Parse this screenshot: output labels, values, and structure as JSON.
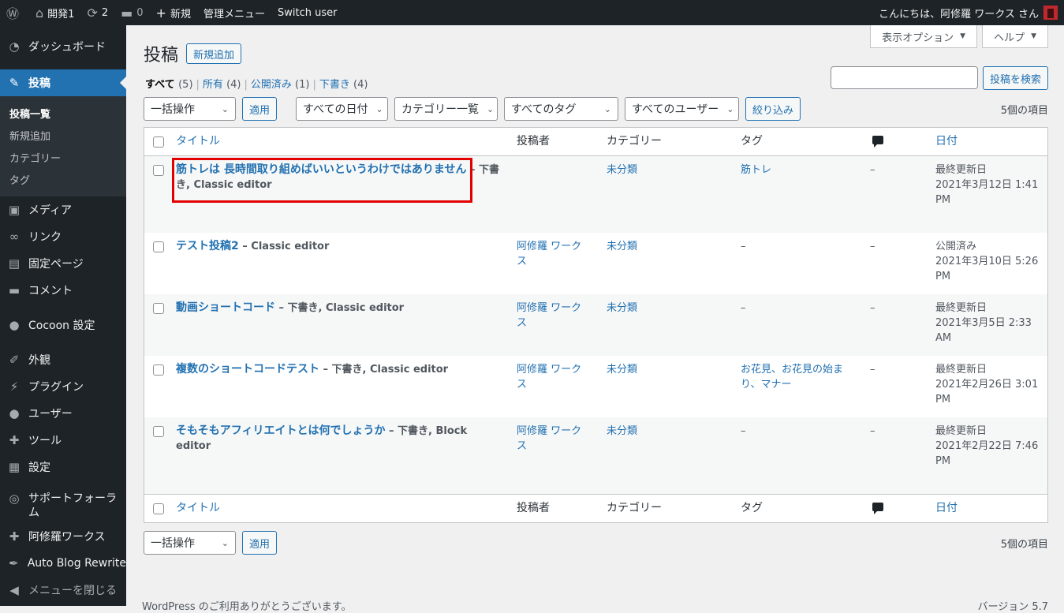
{
  "adminbar": {
    "site_name": "開発1",
    "updates": "2",
    "comments": "0",
    "new_label": "新規",
    "admin_menu": "管理メニュー",
    "switch_user": "Switch user",
    "greeting": "こんにちは、阿修羅 ワークス さん"
  },
  "menu": {
    "dashboard": "ダッシュボード",
    "posts": "投稿",
    "sub": [
      "投稿一覧",
      "新規追加",
      "カテゴリー",
      "タグ"
    ],
    "media": "メディア",
    "links": "リンク",
    "pages": "固定ページ",
    "comments": "コメント",
    "cocoon": "Cocoon 設定",
    "appearance": "外観",
    "plugins": "プラグイン",
    "users": "ユーザー",
    "tools": "ツール",
    "settings": "設定",
    "support": "サポートフォーラム",
    "ashura": "阿修羅ワークス",
    "autoblog": "Auto Blog Rewrite",
    "collapse": "メニューを閉じる"
  },
  "screen_meta": {
    "options": "表示オプション",
    "help": "ヘルプ"
  },
  "page": {
    "title": "投稿",
    "add_new": "新規追加"
  },
  "views": [
    {
      "label": "すべて",
      "count": "(5)"
    },
    {
      "label": "所有",
      "count": "(4)"
    },
    {
      "label": "公開済み",
      "count": "(1)"
    },
    {
      "label": "下書き",
      "count": "(4)"
    }
  ],
  "search": {
    "button": "投稿を検索"
  },
  "filters": {
    "bulk": "一括操作",
    "apply": "適用",
    "dates": "すべての日付",
    "categories": "カテゴリー一覧",
    "tags": "すべてのタグ",
    "users": "すべてのユーザー",
    "filter": "絞り込み",
    "items_count": "5個の項目"
  },
  "columns": {
    "title": "タイトル",
    "author": "投稿者",
    "category": "カテゴリー",
    "tag": "タグ",
    "date": "日付"
  },
  "rows": [
    {
      "title": "筋トレは 長時間取り組めばいいというわけではありません",
      "state": " – 下書き, Classic editor",
      "author": "",
      "category": "未分類",
      "tags": "筋トレ",
      "comments": "–",
      "date_status": "最終更新日",
      "date": "2021年3月12日 1:41 PM"
    },
    {
      "title": "テスト投稿2",
      "state": " – Classic editor",
      "author": "阿修羅 ワークス",
      "category": "未分類",
      "tags": "–",
      "comments": "–",
      "date_status": "公開済み",
      "date": "2021年3月10日 5:26 PM"
    },
    {
      "title": "動画ショートコード",
      "state": " – 下書き, Classic editor",
      "author": "阿修羅 ワークス",
      "category": "未分類",
      "tags": "–",
      "comments": "–",
      "date_status": "最終更新日",
      "date": "2021年3月5日 2:33 AM"
    },
    {
      "title": "複数のショートコードテスト",
      "state": " – 下書き, Classic editor",
      "author": "阿修羅 ワークス",
      "category": "未分類",
      "tags": "お花見、お花見の始まり、マナー",
      "comments": "–",
      "date_status": "最終更新日",
      "date": "2021年2月26日 3:01 PM"
    },
    {
      "title": "そもそもアフィリエイトとは何でしょうか",
      "state": " – 下書き, Block editor",
      "author": "阿修羅 ワークス",
      "category": "未分類",
      "tags": "–",
      "comments": "–",
      "date_status": "最終更新日",
      "date": "2021年2月22日 7:46 PM"
    }
  ],
  "footer": {
    "left": "WordPress のご利用ありがとうございます。",
    "right": "バージョン 5.7"
  }
}
